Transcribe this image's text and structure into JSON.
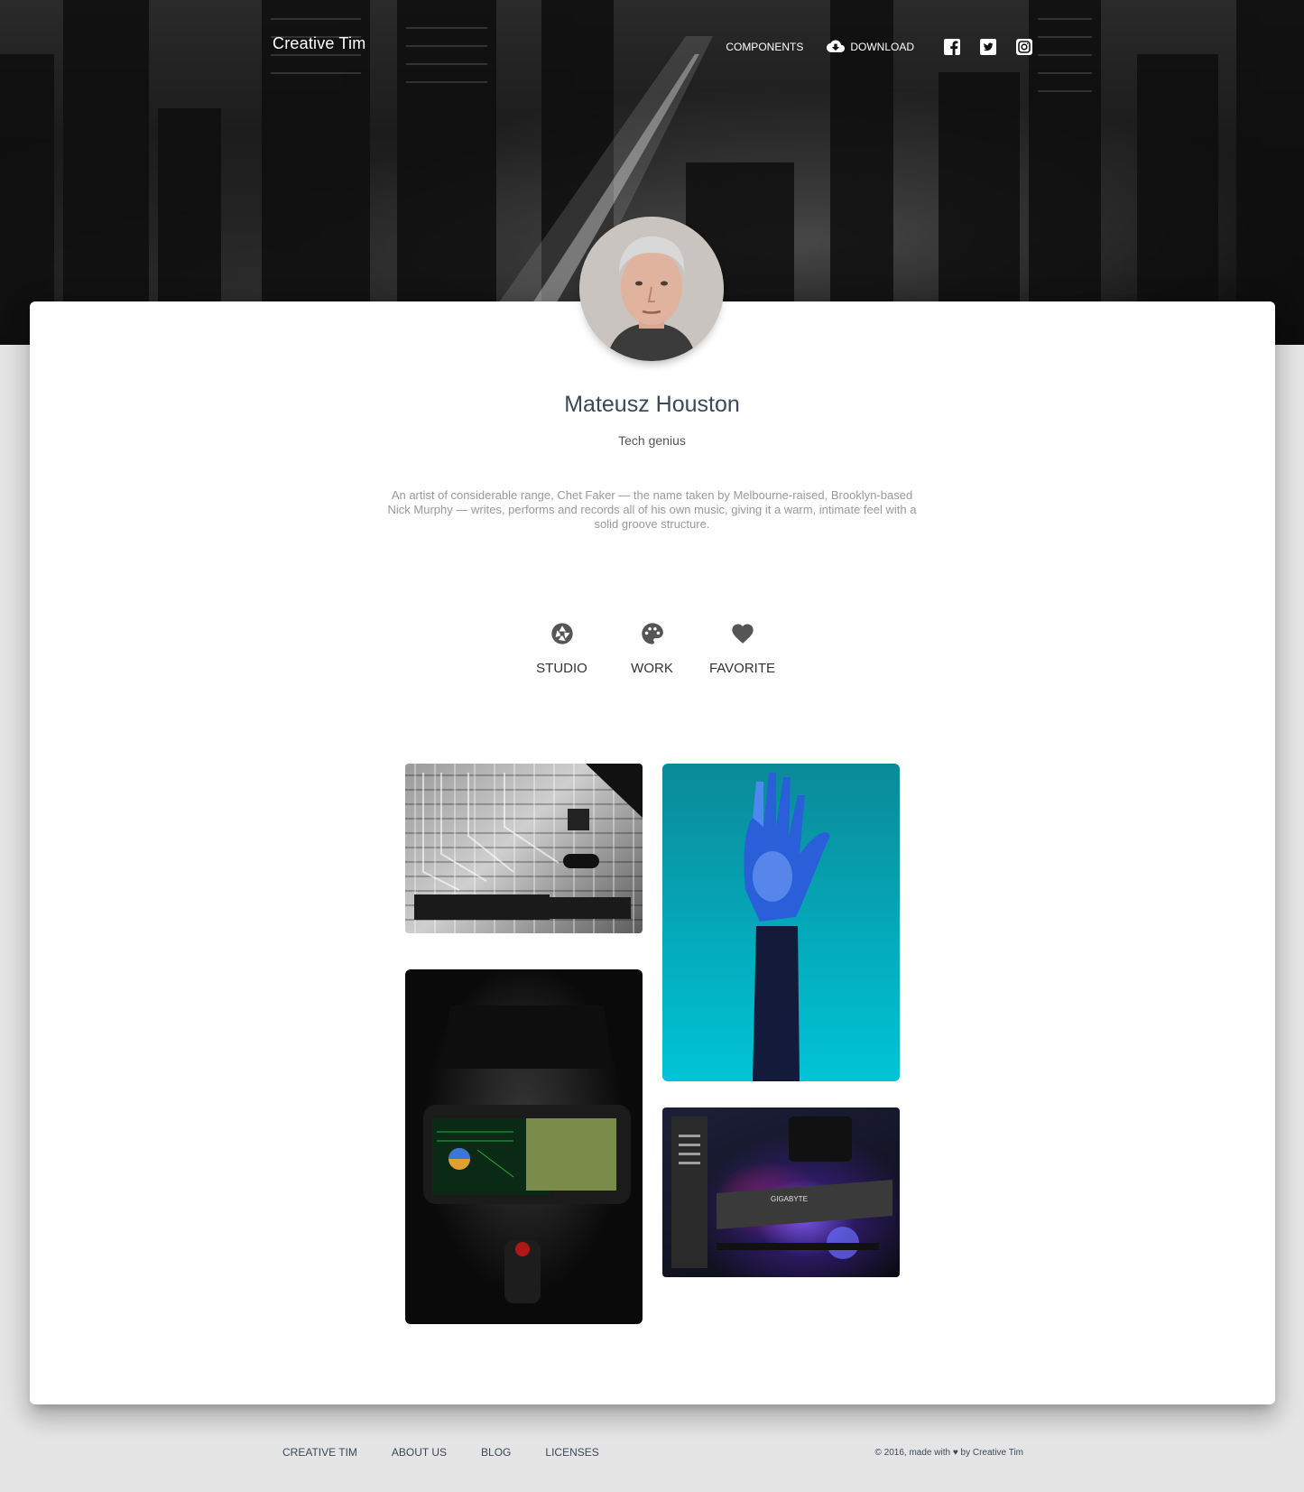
{
  "nav": {
    "brand": "Creative Tim",
    "links": {
      "components": "Components",
      "download": "Download"
    },
    "social_icons": [
      "facebook-icon",
      "twitter-icon",
      "instagram-icon"
    ]
  },
  "profile": {
    "name": "Mateusz Houston",
    "title": "Tech genius",
    "bio": "An artist of considerable range, Chet Faker — the name taken by Melbourne-raised, Brooklyn-based Nick Murphy — writes, performs and records all of his own music, giving it a warm, intimate feel with a solid groove structure."
  },
  "tabs": [
    {
      "label": "Studio",
      "icon": "camera-aperture-icon"
    },
    {
      "label": "Work",
      "icon": "palette-icon"
    },
    {
      "label": "Favorite",
      "icon": "heart-icon"
    }
  ],
  "gallery": [
    {
      "icon": "circuit-board-image"
    },
    {
      "icon": "robotic-hand-image"
    },
    {
      "icon": "cockpit-image"
    },
    {
      "icon": "pc-hardware-image"
    }
  ],
  "footer": {
    "links": [
      "Creative Tim",
      "About Us",
      "Blog",
      "Licenses"
    ],
    "copyright": "© 2016, made with ♥ by Creative Tim"
  },
  "colors": {
    "page_bg": "#e5e5e5",
    "card_bg": "#ffffff",
    "heading": "#3c4858",
    "muted_text": "#999999",
    "icon_dark": "#555555"
  }
}
